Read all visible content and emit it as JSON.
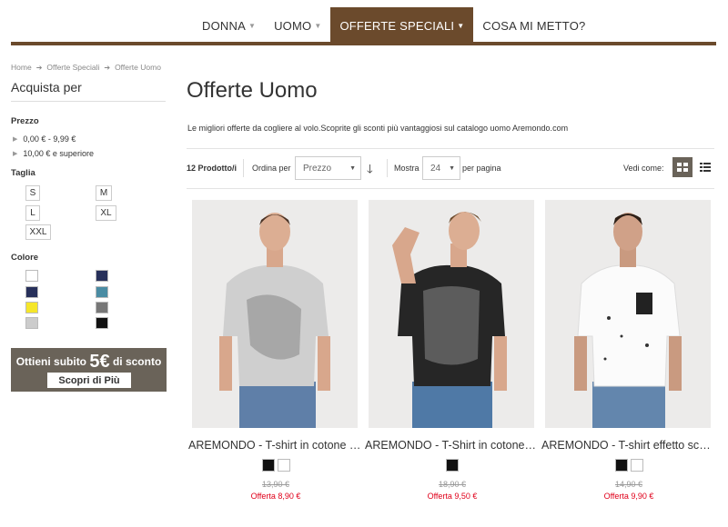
{
  "nav": {
    "items": [
      {
        "label": "DONNA",
        "has_caret": true,
        "active": false
      },
      {
        "label": "UOMO",
        "has_caret": true,
        "active": false
      },
      {
        "label": "OFFERTE SPECIALI",
        "has_caret": true,
        "active": true
      },
      {
        "label": "COSA MI METTO?",
        "has_caret": false,
        "active": false
      }
    ],
    "accent_color": "#6b4a2c"
  },
  "breadcrumb": [
    "Home",
    "Offerte Speciali",
    "Offerte Uomo"
  ],
  "sidebar": {
    "title": "Acquista per",
    "price": {
      "title": "Prezzo",
      "items": [
        "0,00 € - 9,99 €",
        "10,00 € e superiore"
      ]
    },
    "size": {
      "title": "Taglia",
      "items": [
        "S",
        "M",
        "L",
        "XL",
        "XXL"
      ]
    },
    "color": {
      "title": "Colore",
      "swatches": [
        "#ffffff",
        "#27305a",
        "#27305a",
        "#4a8ca3",
        "#f5e62a",
        "#777777",
        "#cccccc",
        "#111111"
      ]
    }
  },
  "promo": {
    "text_before": "Ottieni subito",
    "amount": "5€",
    "text_after": "di sconto",
    "button": "Scopri di Più"
  },
  "main": {
    "title": "Offerte Uomo",
    "intro": "Le migliori offerte da cogliere al volo.Scoprite gli sconti più vantaggiosi sul catalogo uomo Aremondo.com",
    "toolbar": {
      "count": "12 Prodotto/i",
      "sort_label": "Ordina per",
      "sort_value": "Prezzo",
      "show_label": "Mostra",
      "show_value": "24",
      "per_page": "per pagina",
      "view_label": "Vedi come:"
    }
  },
  "products": [
    {
      "name": "AREMONDO - T-shirt in cotone stampata",
      "colors": [
        "#111111",
        "#ffffff"
      ],
      "old_price": "13,90 €",
      "offer": "Offerta 8,90 €"
    },
    {
      "name": "AREMONDO - T-Shirt in cotone stampata",
      "colors": [
        "#111111"
      ],
      "old_price": "18,90 €",
      "offer": "Offerta 9,50 €"
    },
    {
      "name": "AREMONDO - T-shirt effetto schizzi",
      "colors": [
        "#111111",
        "#ffffff"
      ],
      "old_price": "14,90 €",
      "offer": "Offerta 9,90 €"
    }
  ]
}
